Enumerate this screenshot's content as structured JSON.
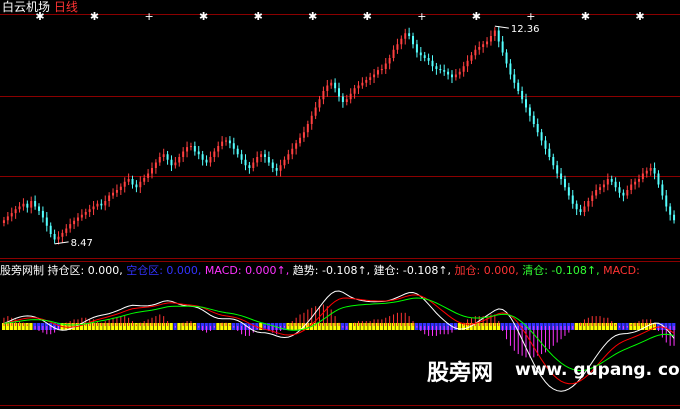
{
  "header": {
    "name": "白云机场",
    "period": "日线",
    "name_color": "#ffffff",
    "period_color": "#ff3333"
  },
  "price_labels": {
    "high": "12.36",
    "low": "8.47"
  },
  "indicator_legend": {
    "title": "股旁网制",
    "items": [
      {
        "label": "持仓区",
        "value": "0.000,",
        "color": "#ffffff"
      },
      {
        "label": "空仓区",
        "value": "0.000,",
        "color": "#3333ff"
      },
      {
        "label": "MACD",
        "value": "0.000↑,",
        "color": "#ff33ff"
      },
      {
        "label": "趋势",
        "value": "-0.108↑,",
        "color": "#ffffff"
      },
      {
        "label": "建仓",
        "value": "-0.108↑,",
        "color": "#ffffff"
      },
      {
        "label": "加仓",
        "value": "0.000,",
        "color": "#ff3333"
      },
      {
        "label": "清仓",
        "value": "-0.108↑,",
        "color": "#33ff33"
      },
      {
        "label": "MACD",
        "value": "",
        "color": "#ff3333"
      }
    ]
  },
  "watermark": {
    "cn": "股旁网",
    "url": "www. gupang. com"
  },
  "colors": {
    "up": "#ff4040",
    "down": "#54ffff",
    "grid": "#8b0000",
    "diff": "#ffffff",
    "dea": "#ffff00",
    "green_line": "#00ff00",
    "red_line": "#ff0000",
    "hold_zone": "#ffff00",
    "empty_zone": "#3333ff",
    "hist_pos": "#ff3333",
    "hist_neg": "#ff33ff"
  },
  "chart_data": {
    "type": "candlestick",
    "price_range": [
      8.2,
      12.6
    ],
    "marker_signals": [
      "star",
      "star",
      "plus",
      "star",
      "star",
      "star",
      "star",
      "plus",
      "star",
      "plus",
      "star",
      "star"
    ],
    "close": [
      8.85,
      8.92,
      8.98,
      9.05,
      9.1,
      9.15,
      9.08,
      9.2,
      9.1,
      9.02,
      8.9,
      8.75,
      8.6,
      8.5,
      8.55,
      8.62,
      8.7,
      8.78,
      8.84,
      8.9,
      8.95,
      9.0,
      9.05,
      9.1,
      9.15,
      9.12,
      9.2,
      9.3,
      9.35,
      9.4,
      9.46,
      9.55,
      9.6,
      9.5,
      9.45,
      9.55,
      9.62,
      9.7,
      9.8,
      9.9,
      10.0,
      10.05,
      9.95,
      9.85,
      9.9,
      10.0,
      10.1,
      10.18,
      10.2,
      10.1,
      10.05,
      9.95,
      9.9,
      10.0,
      10.1,
      10.2,
      10.28,
      10.3,
      10.25,
      10.15,
      10.05,
      9.95,
      9.85,
      9.8,
      9.9,
      10.0,
      10.05,
      10.0,
      9.9,
      9.8,
      9.75,
      9.85,
      9.95,
      10.05,
      10.15,
      10.25,
      10.35,
      10.45,
      10.6,
      10.75,
      10.9,
      11.05,
      11.2,
      11.3,
      11.35,
      11.25,
      11.1,
      11.0,
      11.05,
      11.15,
      11.25,
      11.3,
      11.35,
      11.4,
      11.45,
      11.5,
      11.58,
      11.6,
      11.7,
      11.8,
      11.95,
      12.05,
      12.15,
      12.25,
      12.2,
      12.05,
      11.9,
      11.85,
      11.8,
      11.75,
      11.65,
      11.6,
      11.58,
      11.55,
      11.5,
      11.45,
      11.5,
      11.55,
      11.65,
      11.75,
      11.85,
      11.95,
      12.0,
      12.05,
      12.1,
      12.2,
      12.3,
      12.1,
      11.9,
      11.7,
      11.5,
      11.35,
      11.2,
      11.05,
      10.9,
      10.75,
      10.6,
      10.45,
      10.3,
      10.15,
      10.0,
      9.85,
      9.7,
      9.6,
      9.45,
      9.3,
      9.15,
      9.05,
      9.0,
      9.1,
      9.2,
      9.3,
      9.4,
      9.45,
      9.5,
      9.6,
      9.55,
      9.45,
      9.35,
      9.3,
      9.4,
      9.5,
      9.55,
      9.6,
      9.7,
      9.75,
      9.8,
      9.7,
      9.5,
      9.3,
      9.1,
      8.95,
      8.85
    ],
    "macd_hist": [
      0.05,
      0.06,
      0.05,
      0.04,
      0.03,
      0.02,
      0.01,
      0.0,
      -0.02,
      -0.03,
      -0.04,
      -0.05,
      -0.05,
      -0.04,
      -0.02,
      0.0,
      0.02,
      0.03,
      0.04,
      0.04,
      0.05,
      0.05,
      0.04,
      0.04,
      0.03,
      0.02,
      0.03,
      0.04,
      0.05,
      0.05,
      0.06,
      0.06,
      0.05,
      0.03,
      0.01,
      0.02,
      0.03,
      0.04,
      0.05,
      0.06,
      0.07,
      0.06,
      0.03,
      0.0,
      -0.01,
      0.0,
      0.02,
      0.03,
      0.03,
      0.01,
      -0.01,
      -0.03,
      -0.04,
      -0.03,
      -0.01,
      0.0,
      0.02,
      0.02,
      0.01,
      -0.01,
      -0.03,
      -0.05,
      -0.06,
      -0.06,
      -0.04,
      -0.02,
      0.0,
      -0.01,
      -0.03,
      -0.04,
      -0.05,
      -0.03,
      -0.01,
      0.01,
      0.03,
      0.05,
      0.07,
      0.08,
      0.1,
      0.11,
      0.12,
      0.12,
      0.13,
      0.12,
      0.1,
      0.06,
      0.02,
      -0.01,
      -0.02,
      0.0,
      0.02,
      0.03,
      0.03,
      0.03,
      0.03,
      0.04,
      0.04,
      0.04,
      0.05,
      0.06,
      0.07,
      0.08,
      0.08,
      0.08,
      0.06,
      0.03,
      -0.01,
      -0.03,
      -0.05,
      -0.06,
      -0.06,
      -0.06,
      -0.05,
      -0.05,
      -0.05,
      -0.04,
      -0.02,
      0.0,
      0.02,
      0.04,
      0.05,
      0.06,
      0.06,
      0.06,
      0.06,
      0.07,
      0.07,
      0.03,
      -0.03,
      -0.08,
      -0.12,
      -0.15,
      -0.17,
      -0.18,
      -0.19,
      -0.19,
      -0.19,
      -0.18,
      -0.17,
      -0.16,
      -0.14,
      -0.12,
      -0.1,
      -0.08,
      -0.06,
      -0.04,
      -0.02,
      0.0,
      0.02,
      0.04,
      0.05,
      0.06,
      0.06,
      0.06,
      0.05,
      0.05,
      0.03,
      0.01,
      -0.01,
      -0.02,
      -0.01,
      0.01,
      0.02,
      0.03,
      0.04,
      0.04,
      0.04,
      0.01,
      -0.03,
      -0.07,
      -0.1,
      -0.12,
      -0.12
    ]
  }
}
